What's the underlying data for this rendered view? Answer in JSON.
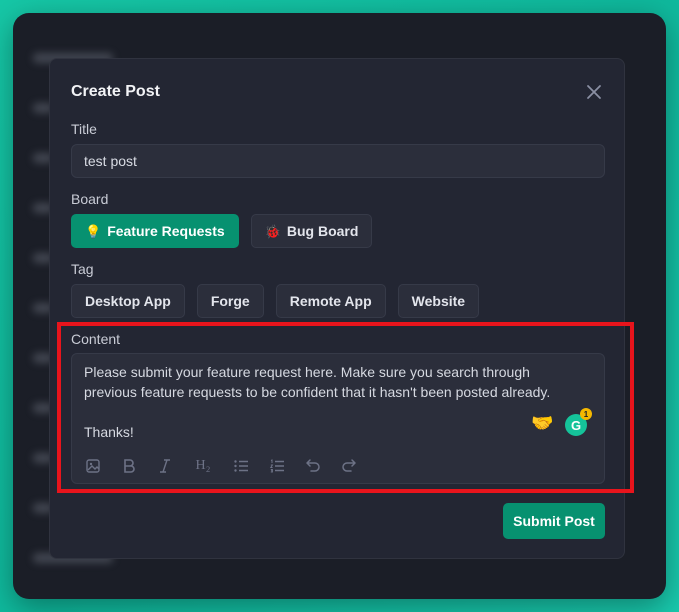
{
  "modal": {
    "title": "Create Post",
    "title_label": "Title",
    "title_value": "test post",
    "board_label": "Board",
    "boards": [
      {
        "label": "Feature Requests",
        "icon": "lightbulb-icon",
        "glyph": "💡",
        "active": true
      },
      {
        "label": "Bug Board",
        "icon": "bug-icon",
        "glyph": "🐞",
        "active": false
      }
    ],
    "tag_label": "Tag",
    "tags": [
      "Desktop App",
      "Forge",
      "Remote App",
      "Website"
    ],
    "content_label": "Content",
    "content": {
      "line1": "Please submit your feature request here. Make sure you search through",
      "line2": "previous feature requests to be confident that it hasn't been posted already.",
      "line3": "Thanks!"
    },
    "grammarly": {
      "letter": "G",
      "count": "1"
    },
    "toolbar": {
      "heading_label": "H₂"
    },
    "submit_label": "Submit Post"
  },
  "colors": {
    "accent": "#079170",
    "highlight": "#e8141c",
    "modal_bg": "#232633"
  }
}
